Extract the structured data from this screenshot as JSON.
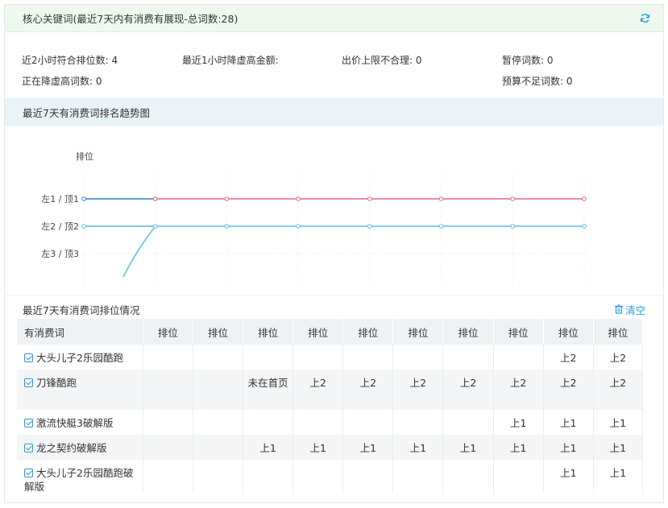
{
  "header": {
    "title": "核心关键词(最近7天内有消费有展现-总词数:28)",
    "refresh_icon": "refresh-icon"
  },
  "stats": [
    {
      "label": "近2小时符合排位数: 4"
    },
    {
      "label": "最近1小时降虚高金额:"
    },
    {
      "label": "出价上限不合理: 0"
    },
    {
      "label": "暂停词数: 0"
    },
    {
      "label": "正在降虚高词数: 0"
    },
    {
      "label": "预算不足词数: 0"
    }
  ],
  "trend_section": {
    "title": "最近7天有消费词排名趋势图"
  },
  "chart_data": {
    "type": "line",
    "ylabel": "排位",
    "y_categories": [
      "左1 / 顶1",
      "左2 / 顶2",
      "左3 / 顶3"
    ],
    "x_count": 8,
    "series": [
      {
        "color": "#2f7fd0",
        "values": [
          1,
          1
        ]
      },
      {
        "color": "#e8678a",
        "values": [
          null,
          1,
          1,
          1,
          1,
          1,
          1,
          1
        ]
      },
      {
        "color": "#f2c43d",
        "values": [
          2,
          2
        ]
      },
      {
        "color": "#58c2ea",
        "values": [
          2,
          2,
          2,
          2,
          2,
          2,
          2,
          2
        ]
      }
    ],
    "grid": true
  },
  "table_section": {
    "title": "最近7天有消费词排位情况",
    "clear_label": "清空",
    "clear_icon": "trash-icon"
  },
  "table": {
    "headers": [
      "有消费词",
      "排位",
      "排位",
      "排位",
      "排位",
      "排位",
      "排位",
      "排位",
      "排位",
      "排位",
      "排位"
    ],
    "rows": [
      {
        "keyword": "大头儿子2乐园酷跑",
        "cells": [
          "",
          "",
          "",
          "",
          "",
          "",
          "",
          "",
          "上2",
          "上2"
        ]
      },
      {
        "keyword": "刀锋酷跑",
        "cells": [
          "",
          "",
          "未在首页",
          "上2",
          "上2",
          "上2",
          "上2",
          "上2",
          "上2",
          "上2"
        ]
      },
      {
        "keyword": "激流快艇3破解版",
        "cells": [
          "",
          "",
          "",
          "",
          "",
          "",
          "",
          "上1",
          "上1",
          "上1"
        ]
      },
      {
        "keyword": "龙之契约破解版",
        "cells": [
          "",
          "",
          "上1",
          "上1",
          "上1",
          "上1",
          "上1",
          "上1",
          "上1",
          "上1"
        ]
      },
      {
        "keyword": "大头儿子2乐园酷跑破解版",
        "cells": [
          "",
          "",
          "",
          "",
          "",
          "",
          "",
          "",
          "上1",
          "上1"
        ]
      }
    ]
  }
}
